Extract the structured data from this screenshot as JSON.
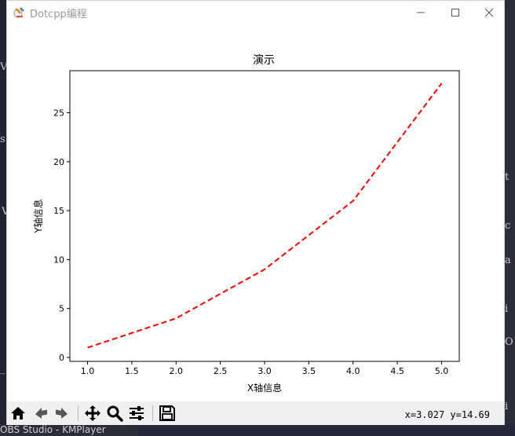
{
  "window": {
    "title": "Dotcpp编程"
  },
  "background": {
    "left_letters": [
      "V",
      "s",
      "V",
      "_"
    ],
    "right_letters": [
      "t",
      "c",
      "a",
      "i",
      "O",
      "i"
    ],
    "taskbar_text": "OBS Studio - KMPlayer"
  },
  "toolbar": {
    "buttons": [
      {
        "name": "home-button",
        "icon": "home-icon"
      },
      {
        "name": "back-button",
        "icon": "arrow-left-icon"
      },
      {
        "name": "forward-button",
        "icon": "arrow-right-icon"
      },
      {
        "name": "pan-button",
        "icon": "move-icon"
      },
      {
        "name": "zoom-button",
        "icon": "magnifier-icon"
      },
      {
        "name": "configure-subplots-button",
        "icon": "sliders-icon"
      },
      {
        "name": "save-button",
        "icon": "floppy-disk-icon"
      }
    ],
    "coords": "x=3.027 y=14.69"
  },
  "chart_data": {
    "type": "line",
    "title": "演示",
    "xlabel": "X轴信息",
    "ylabel": "Y轴信息",
    "x": [
      1,
      2,
      3,
      4,
      5
    ],
    "series": [
      {
        "values": [
          1,
          4,
          9,
          16,
          28
        ],
        "color": "#ff0000",
        "linestyle": "dashed"
      }
    ],
    "xlim": [
      0.8,
      5.2
    ],
    "ylim": [
      -0.4,
      29.3
    ],
    "xticks": [
      1.0,
      1.5,
      2.0,
      2.5,
      3.0,
      3.5,
      4.0,
      4.5,
      5.0
    ],
    "xtick_labels": [
      "1.0",
      "1.5",
      "2.0",
      "2.5",
      "3.0",
      "3.5",
      "4.0",
      "4.5",
      "5.0"
    ],
    "yticks": [
      0,
      5,
      10,
      15,
      20,
      25
    ],
    "ytick_labels": [
      "0",
      "5",
      "10",
      "15",
      "20",
      "25"
    ],
    "grid": false
  }
}
